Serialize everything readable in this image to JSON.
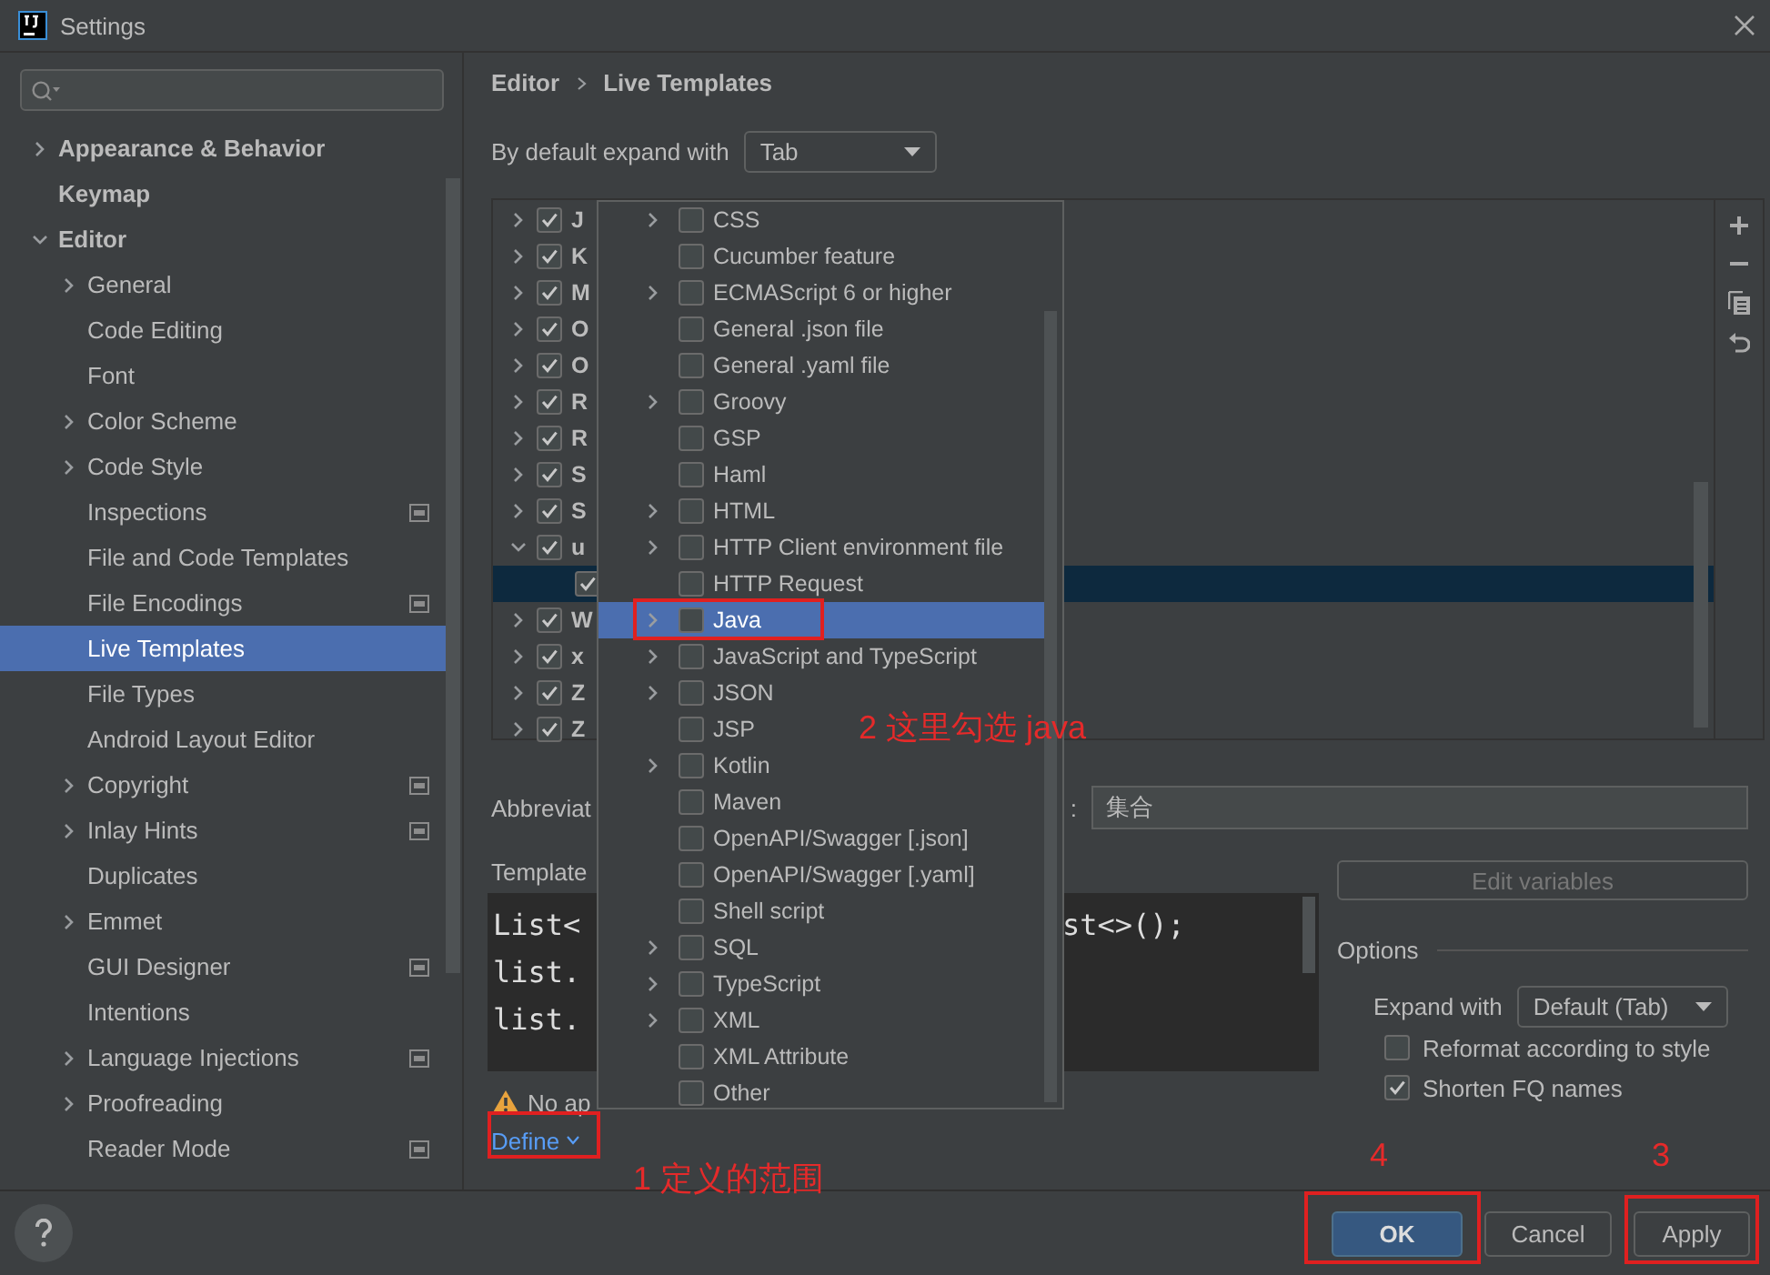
{
  "window": {
    "title": "Settings"
  },
  "sidebar": {
    "items": [
      {
        "label": "Appearance & Behavior",
        "expanded": false,
        "selected": false,
        "project_scope": false
      },
      {
        "label": "Keymap",
        "selected": false,
        "project_scope": false
      },
      {
        "label": "Editor",
        "expanded": true,
        "selected": false,
        "project_scope": false,
        "children": [
          {
            "label": "General",
            "expanded": false,
            "selected": false,
            "project_scope": false
          },
          {
            "label": "Code Editing",
            "selected": false,
            "project_scope": false
          },
          {
            "label": "Font",
            "selected": false,
            "project_scope": false
          },
          {
            "label": "Color Scheme",
            "expanded": false,
            "selected": false,
            "project_scope": false
          },
          {
            "label": "Code Style",
            "expanded": false,
            "selected": false,
            "project_scope": false
          },
          {
            "label": "Inspections",
            "selected": false,
            "project_scope": true
          },
          {
            "label": "File and Code Templates",
            "selected": false,
            "project_scope": false
          },
          {
            "label": "File Encodings",
            "selected": false,
            "project_scope": true
          },
          {
            "label": "Live Templates",
            "selected": true,
            "project_scope": false
          },
          {
            "label": "File Types",
            "selected": false,
            "project_scope": false
          },
          {
            "label": "Android Layout Editor",
            "selected": false,
            "project_scope": false
          },
          {
            "label": "Copyright",
            "expanded": false,
            "selected": false,
            "project_scope": true
          },
          {
            "label": "Inlay Hints",
            "expanded": false,
            "selected": false,
            "project_scope": true
          },
          {
            "label": "Duplicates",
            "selected": false,
            "project_scope": false
          },
          {
            "label": "Emmet",
            "expanded": false,
            "selected": false,
            "project_scope": false
          },
          {
            "label": "GUI Designer",
            "selected": false,
            "project_scope": true
          },
          {
            "label": "Intentions",
            "selected": false,
            "project_scope": false
          },
          {
            "label": "Language Injections",
            "expanded": false,
            "selected": false,
            "project_scope": true
          },
          {
            "label": "Proofreading",
            "expanded": false,
            "selected": false,
            "project_scope": false
          },
          {
            "label": "Reader Mode",
            "selected": false,
            "project_scope": true
          }
        ]
      }
    ]
  },
  "breadcrumb": [
    "Editor",
    "Live Templates"
  ],
  "expand_default": {
    "label": "By default expand with",
    "value": "Tab"
  },
  "templates": [
    {
      "label": "J",
      "expanded": false,
      "checked": true,
      "selected": false
    },
    {
      "label": "K",
      "expanded": false,
      "checked": true,
      "selected": false
    },
    {
      "label": "M",
      "expanded": false,
      "checked": true,
      "selected": false
    },
    {
      "label": "O",
      "expanded": false,
      "checked": true,
      "selected": false
    },
    {
      "label": "O",
      "expanded": false,
      "checked": true,
      "selected": false
    },
    {
      "label": "R",
      "expanded": false,
      "checked": true,
      "selected": false
    },
    {
      "label": "R",
      "expanded": false,
      "checked": true,
      "selected": false
    },
    {
      "label": "S",
      "expanded": false,
      "checked": true,
      "selected": false
    },
    {
      "label": "S",
      "expanded": false,
      "checked": true,
      "selected": false
    },
    {
      "label": "u",
      "expanded": true,
      "checked": true,
      "selected": false,
      "children": [
        {
          "checked": true,
          "selected": true
        }
      ]
    },
    {
      "label": "W",
      "expanded": false,
      "checked": true,
      "selected": false
    },
    {
      "label": "x",
      "expanded": false,
      "checked": true,
      "selected": false
    },
    {
      "label": "Z",
      "expanded": false,
      "checked": true,
      "selected": false
    },
    {
      "label": "Z",
      "expanded": false,
      "checked": true,
      "selected": false
    }
  ],
  "abbreviation": {
    "label": "Abbreviat",
    "colon": ":",
    "value": "集合"
  },
  "template_text": {
    "label": "Template",
    "lines": [
      {
        "left": "List<",
        "right": "st<>();"
      },
      {
        "left": "list."
      },
      {
        "left": "list."
      }
    ]
  },
  "edit_variables": {
    "label": "Edit variables",
    "disabled": true
  },
  "options": {
    "title": "Options",
    "expand_with": {
      "label": "Expand with",
      "value": "Default (Tab)"
    },
    "checkboxes": [
      {
        "label": "Reformat according to style",
        "checked": false
      },
      {
        "label": "Shorten FQ names",
        "checked": true
      }
    ]
  },
  "warning": "No ap",
  "define": {
    "label": "Define",
    "annotated": true
  },
  "popup": {
    "items": [
      {
        "label": "CSS",
        "expandable": true,
        "checked": false,
        "selected": false,
        "annotated": false
      },
      {
        "label": "Cucumber feature",
        "expandable": false,
        "checked": false,
        "selected": false,
        "annotated": false
      },
      {
        "label": "ECMAScript 6 or higher",
        "expandable": true,
        "checked": false,
        "selected": false,
        "annotated": false
      },
      {
        "label": "General .json file",
        "expandable": false,
        "checked": false,
        "selected": false,
        "annotated": false
      },
      {
        "label": "General .yaml file",
        "expandable": false,
        "checked": false,
        "selected": false,
        "annotated": false
      },
      {
        "label": "Groovy",
        "expandable": true,
        "checked": false,
        "selected": false,
        "annotated": false
      },
      {
        "label": "GSP",
        "expandable": false,
        "checked": false,
        "selected": false,
        "annotated": false
      },
      {
        "label": "Haml",
        "expandable": false,
        "checked": false,
        "selected": false,
        "annotated": false
      },
      {
        "label": "HTML",
        "expandable": true,
        "checked": false,
        "selected": false,
        "annotated": false
      },
      {
        "label": "HTTP Client environment file",
        "expandable": true,
        "checked": false,
        "selected": false,
        "annotated": false
      },
      {
        "label": "HTTP Request",
        "expandable": false,
        "checked": false,
        "selected": false,
        "annotated": false
      },
      {
        "label": "Java",
        "expandable": true,
        "checked": false,
        "selected": true,
        "annotated": true
      },
      {
        "label": "JavaScript and TypeScript",
        "expandable": true,
        "checked": false,
        "selected": false,
        "annotated": false
      },
      {
        "label": "JSON",
        "expandable": true,
        "checked": false,
        "selected": false,
        "annotated": false
      },
      {
        "label": "JSP",
        "expandable": false,
        "checked": false,
        "selected": false,
        "annotated": false
      },
      {
        "label": "Kotlin",
        "expandable": true,
        "checked": false,
        "selected": false,
        "annotated": false
      },
      {
        "label": "Maven",
        "expandable": false,
        "checked": false,
        "selected": false,
        "annotated": false
      },
      {
        "label": "OpenAPI/Swagger [.json]",
        "expandable": false,
        "checked": false,
        "selected": false,
        "annotated": false
      },
      {
        "label": "OpenAPI/Swagger [.yaml]",
        "expandable": false,
        "checked": false,
        "selected": false,
        "annotated": false
      },
      {
        "label": "Shell script",
        "expandable": false,
        "checked": false,
        "selected": false,
        "annotated": false
      },
      {
        "label": "SQL",
        "expandable": true,
        "checked": false,
        "selected": false,
        "annotated": false
      },
      {
        "label": "TypeScript",
        "expandable": true,
        "checked": false,
        "selected": false,
        "annotated": false
      },
      {
        "label": "XML",
        "expandable": true,
        "checked": false,
        "selected": false,
        "annotated": false
      },
      {
        "label": "XML Attribute",
        "expandable": false,
        "checked": false,
        "selected": false,
        "annotated": false
      },
      {
        "label": "Other",
        "expandable": false,
        "checked": false,
        "selected": false,
        "annotated": false
      }
    ]
  },
  "buttons": [
    {
      "label": "OK",
      "kind": "primary",
      "annotated": true
    },
    {
      "label": "Cancel",
      "kind": "normal",
      "annotated": false
    },
    {
      "label": "Apply",
      "kind": "normal",
      "annotated": true
    }
  ],
  "annotations": [
    {
      "text": "1 定义的范围"
    },
    {
      "text": "2 这里勾选 java"
    },
    {
      "text": "3"
    },
    {
      "text": "4"
    }
  ]
}
